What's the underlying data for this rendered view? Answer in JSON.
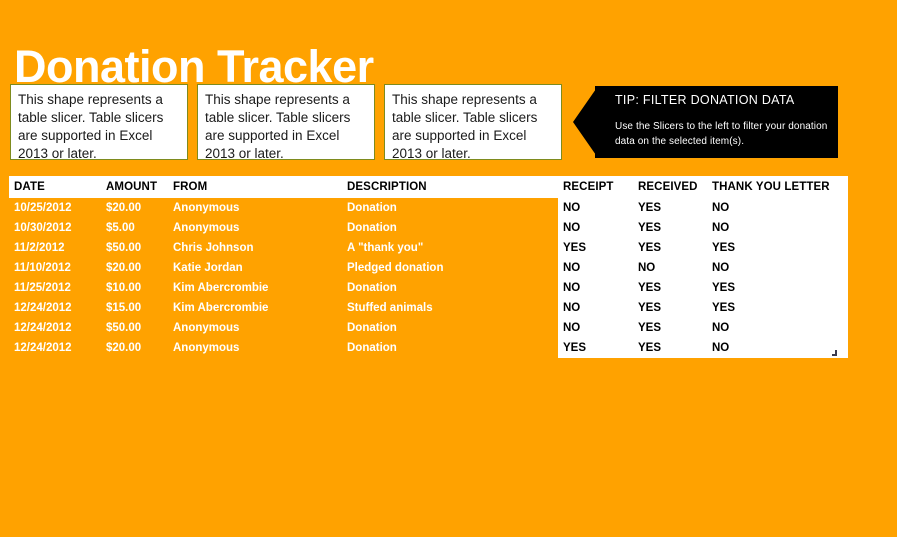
{
  "page": {
    "title": "Donation Tracker",
    "background_color": "#FFA200",
    "title_color": "#FFFFFF"
  },
  "slicers": [
    {
      "text": "This shape represents a table slicer.  Table slicers are supported in Excel 2013 or later."
    },
    {
      "text": "This shape represents a table slicer.  Table slicers are supported in Excel 2013 or later."
    },
    {
      "text": "This shape represents a table slicer.  Table slicers are supported in Excel 2013 or later."
    }
  ],
  "tip": {
    "title": "TIP: FILTER DONATION DATA",
    "body": "Use the Slicers to the left to filter your donation data on the selected item(s).",
    "background_color": "#000000",
    "text_color": "#FFFFFF"
  },
  "table": {
    "columns": [
      {
        "key": "date",
        "label": "DATE"
      },
      {
        "key": "amount",
        "label": "AMOUNT"
      },
      {
        "key": "from",
        "label": "FROM"
      },
      {
        "key": "desc",
        "label": "DESCRIPTION"
      },
      {
        "key": "receipt",
        "label": "RECEIPT"
      },
      {
        "key": "received",
        "label": "RECEIVED"
      },
      {
        "key": "thankyou",
        "label": "THANK YOU LETTER"
      }
    ],
    "rows": [
      {
        "date": "10/25/2012",
        "amount": "$20.00",
        "from": "Anonymous",
        "desc": "Donation",
        "receipt": "NO",
        "received": "YES",
        "thankyou": "NO"
      },
      {
        "date": "10/30/2012",
        "amount": "$5.00",
        "from": "Anonymous",
        "desc": "Donation",
        "receipt": "NO",
        "received": "YES",
        "thankyou": "NO"
      },
      {
        "date": "11/2/2012",
        "amount": "$50.00",
        "from": "Chris Johnson",
        "desc": "A \"thank you\"",
        "receipt": "YES",
        "received": "YES",
        "thankyou": "YES"
      },
      {
        "date": "11/10/2012",
        "amount": "$20.00",
        "from": "Katie Jordan",
        "desc": "Pledged donation",
        "receipt": "NO",
        "received": "NO",
        "thankyou": "NO"
      },
      {
        "date": "11/25/2012",
        "amount": "$10.00",
        "from": "Kim Abercrombie",
        "desc": "Donation",
        "receipt": "NO",
        "received": "YES",
        "thankyou": "YES"
      },
      {
        "date": "12/24/2012",
        "amount": "$15.00",
        "from": "Kim Abercrombie",
        "desc": "Stuffed animals",
        "receipt": "NO",
        "received": "YES",
        "thankyou": "YES"
      },
      {
        "date": "12/24/2012",
        "amount": "$50.00",
        "from": "Anonymous",
        "desc": "Donation",
        "receipt": "NO",
        "received": "YES",
        "thankyou": "NO"
      },
      {
        "date": "12/24/2012",
        "amount": "$20.00",
        "from": "Anonymous",
        "desc": "Donation",
        "receipt": "YES",
        "received": "YES",
        "thankyou": "NO"
      }
    ],
    "header_background_color": "#FFFFFF",
    "header_text_color": "#000000",
    "left_group_background_color": "#FFA200",
    "left_group_text_color": "#FFFFFF",
    "right_group_background_color": "#FFFFFF",
    "right_group_text_color": "#000000"
  }
}
